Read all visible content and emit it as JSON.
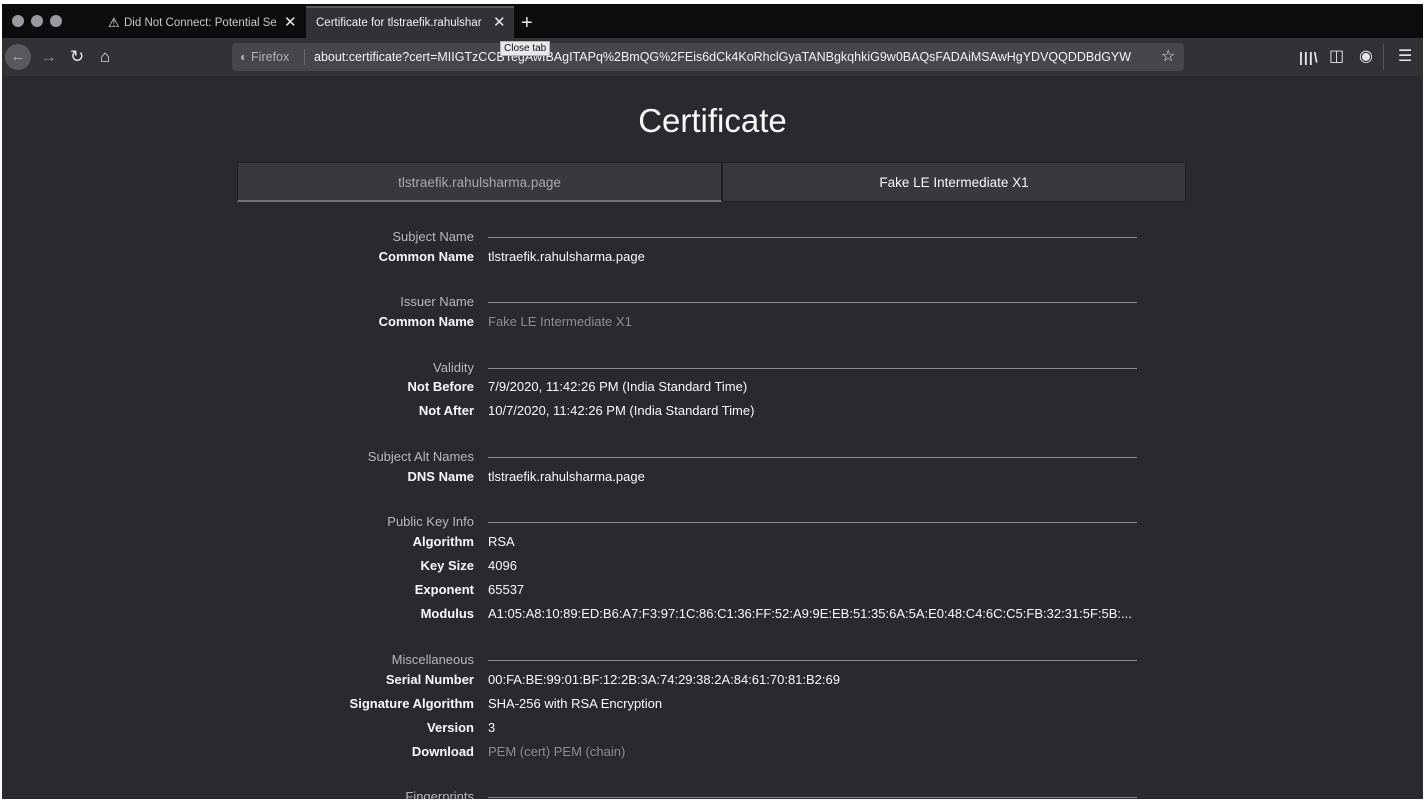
{
  "browser": {
    "tabs": [
      {
        "title": "Did Not Connect: Potential Sec",
        "icon": "warning-icon",
        "active": false
      },
      {
        "title": "Certificate for tlstraefik.rahulsharm",
        "active": true
      }
    ],
    "tooltip": "Close tab",
    "identity_label": "Firefox",
    "url": "about:certificate?cert=MIIGTzCCBTegAwIBAgITAPq%2BmQG%2FEis6dCk4KoRhclGyaTANBgkqhkiG9w0BAQsFADAiMSAwHgYDVQQDDBdGYW"
  },
  "page": {
    "title": "Certificate",
    "cert_tabs": [
      "tlstraefik.rahulsharma.page",
      "Fake LE Intermediate X1"
    ],
    "sections": {
      "subject": {
        "heading": "Subject Name",
        "rows": [
          {
            "key": "Common Name",
            "value": "tlstraefik.rahulsharma.page"
          }
        ]
      },
      "issuer": {
        "heading": "Issuer Name",
        "rows": [
          {
            "key": "Common Name",
            "value": "Fake LE Intermediate X1"
          }
        ]
      },
      "validity": {
        "heading": "Validity",
        "rows": [
          {
            "key": "Not Before",
            "value": "7/9/2020, 11:42:26 PM (India Standard Time)"
          },
          {
            "key": "Not After",
            "value": "10/7/2020, 11:42:26 PM (India Standard Time)"
          }
        ]
      },
      "san": {
        "heading": "Subject Alt Names",
        "rows": [
          {
            "key": "DNS Name",
            "value": "tlstraefik.rahulsharma.page"
          }
        ]
      },
      "pubkey": {
        "heading": "Public Key Info",
        "rows": [
          {
            "key": "Algorithm",
            "value": "RSA"
          },
          {
            "key": "Key Size",
            "value": "4096"
          },
          {
            "key": "Exponent",
            "value": "65537"
          },
          {
            "key": "Modulus",
            "value": "A1:05:A8:10:89:ED:B6:A7:F3:97:1C:86:C1:36:FF:52:A9:9E:EB:51:35:6A:5A:E0:48:C4:6C:C5:FB:32:31:5F:5B:..."
          }
        ]
      },
      "misc": {
        "heading": "Miscellaneous",
        "rows": [
          {
            "key": "Serial Number",
            "value": "00:FA:BE:99:01:BF:12:2B:3A:74:29:38:2A:84:61:70:81:B2:69"
          },
          {
            "key": "Signature Algorithm",
            "value": "SHA-256 with RSA Encryption"
          },
          {
            "key": "Version",
            "value": "3"
          },
          {
            "key": "Download",
            "links": [
              "PEM (cert)",
              "PEM (chain)"
            ]
          }
        ]
      },
      "fingerprints": {
        "heading": "Fingerprints"
      }
    }
  }
}
